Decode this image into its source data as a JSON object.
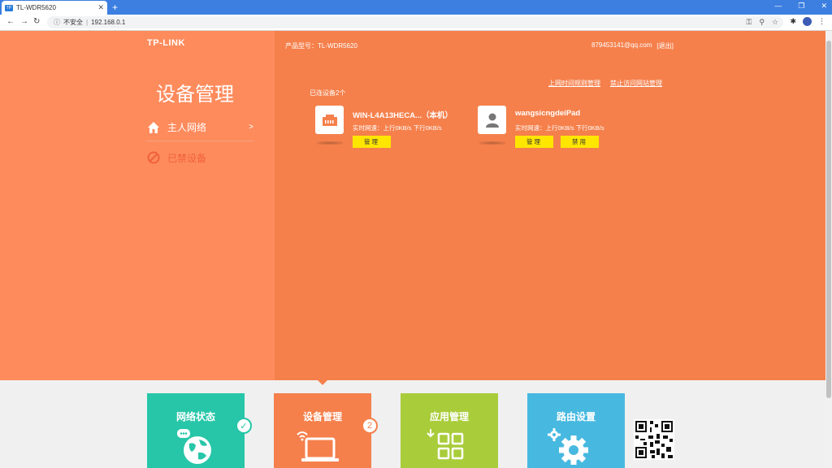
{
  "browser": {
    "tab_title": "TL-WDR5620",
    "favicon_text": "TP",
    "address_security": "不安全",
    "address_url": "192.168.0.1"
  },
  "header": {
    "logo": "TP-LINK",
    "product_model": "产品型号：TL-WDR5620",
    "account": "879453141@qq.com",
    "logout": "[退出]"
  },
  "sidebar": {
    "title": "设备管理",
    "items": [
      {
        "label": "主人网络",
        "arrow": ">"
      },
      {
        "label": "已禁设备"
      }
    ]
  },
  "main": {
    "links": [
      "上网时间规则管理",
      "禁止访问网站管理"
    ],
    "connected_count": "已连设备2个",
    "devices": [
      {
        "name": "WIN-L4A13HECA...（本机）",
        "speed": "实时网速：上行0KB/s  下行0KB/s",
        "buttons": [
          "管理"
        ]
      },
      {
        "name": "wangsicngdeiPad",
        "speed": "实时网速：上行0KB/s  下行0KB/s",
        "buttons": [
          "管理",
          "禁用"
        ]
      }
    ]
  },
  "tiles": [
    {
      "label": "网络状态",
      "color": "#27c6a8",
      "icon": "globe-icon",
      "badge": "check"
    },
    {
      "label": "设备管理",
      "color": "#f5804c",
      "icon": "laptop-icon",
      "badge": "2"
    },
    {
      "label": "应用管理",
      "color": "#a9cc3a",
      "icon": "apps-icon"
    },
    {
      "label": "路由设置",
      "color": "#47b9e0",
      "icon": "settings-icon"
    }
  ]
}
